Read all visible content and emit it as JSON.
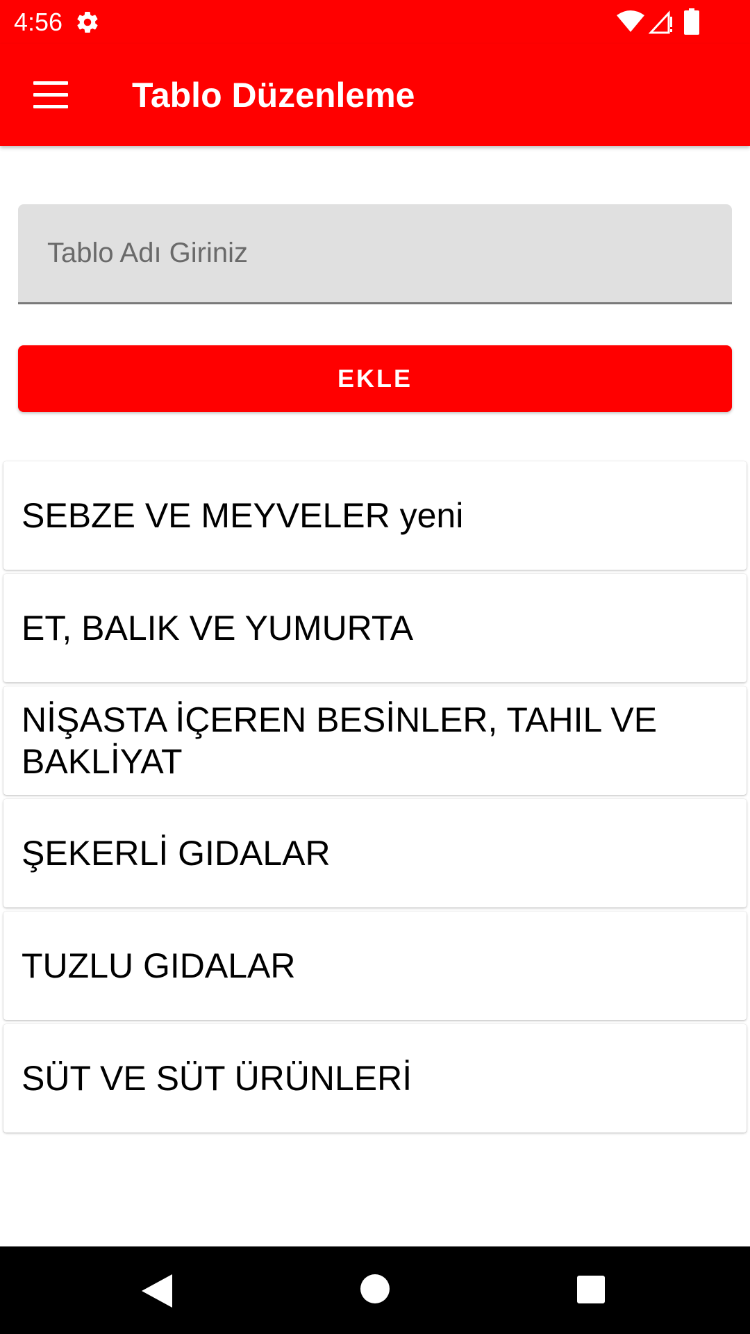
{
  "status_bar": {
    "time": "4:56",
    "icons": [
      "gear-icon",
      "wifi-icon",
      "signal-icon",
      "battery-icon"
    ]
  },
  "app_bar": {
    "title": "Tablo Düzenleme",
    "menu_icon": "hamburger-menu-icon"
  },
  "form": {
    "input_placeholder": "Tablo Adı Giriniz",
    "input_value": "",
    "add_button_label": "EKLE"
  },
  "tables": [
    {
      "label": "SEBZE VE MEYVELER yeni"
    },
    {
      "label": "ET, BALIK VE YUMURTA"
    },
    {
      "label": "NİŞASTA İÇEREN BESİNLER, TAHIL VE BAKLİYAT"
    },
    {
      "label": "ŞEKERLİ GIDALAR"
    },
    {
      "label": "TUZLU GIDALAR"
    },
    {
      "label": "SÜT VE SÜT ÜRÜNLERİ"
    }
  ],
  "nav_bar": {
    "icons": [
      "back-icon",
      "home-icon",
      "recents-icon"
    ]
  },
  "colors": {
    "primary": "#ff0000",
    "input_bg": "#e0e0e0",
    "text": "#000000"
  }
}
